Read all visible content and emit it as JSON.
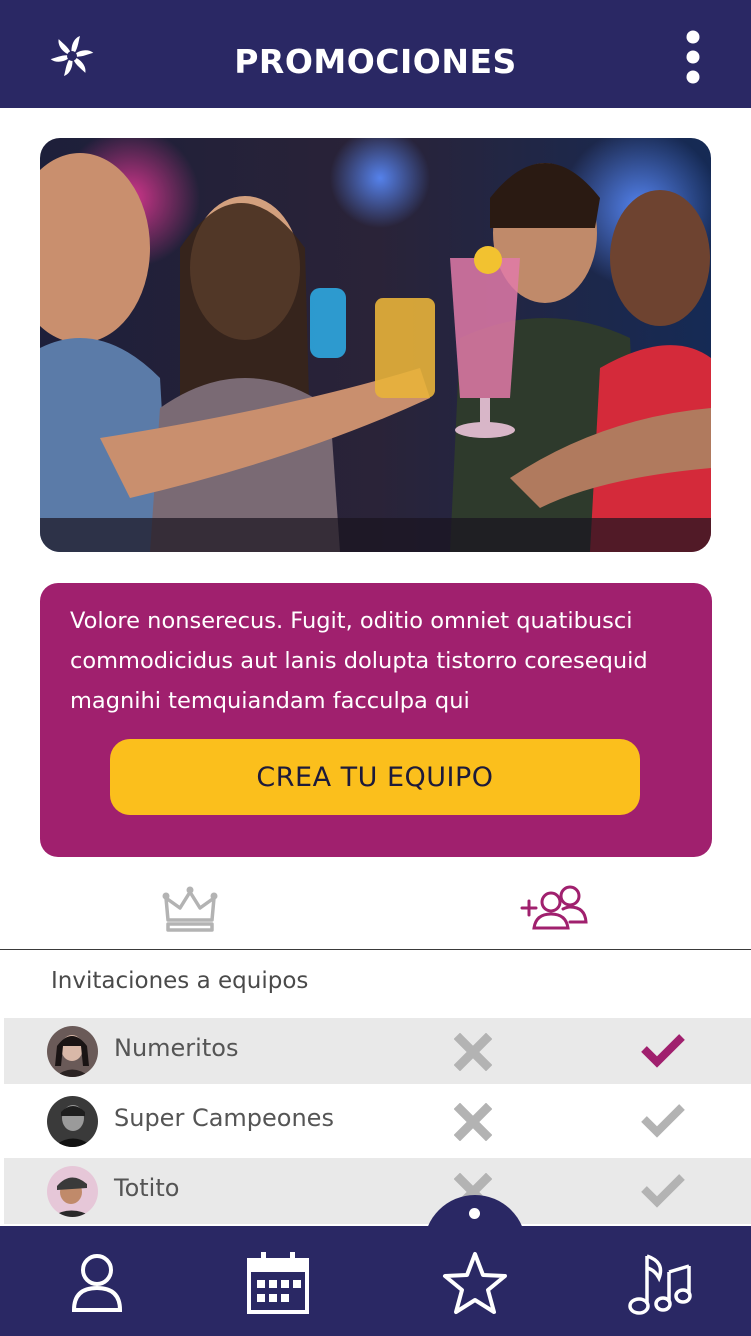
{
  "header": {
    "title": "PROMOCIONES",
    "logo_icon": "pinwheel-logo-icon",
    "menu_icon": "kebab-menu-icon"
  },
  "colors": {
    "navy": "#2a2864",
    "magenta": "#a0206e",
    "yellow": "#fbbf1c"
  },
  "promo": {
    "text": "Volore nonserecus. Fugit, oditio omniet quatibusci commodicidus aut lanis dolupta tistorro coresequid magnihi temquiandam facculpa qui",
    "cta_label": "CREA TU EQUIPO"
  },
  "tabs": [
    {
      "icon": "crown-icon",
      "active": false
    },
    {
      "icon": "add-group-icon",
      "active": true
    }
  ],
  "invitations": {
    "title": "Invitaciones a equipos",
    "rows": [
      {
        "name": "Numeritos",
        "accepted": true
      },
      {
        "name": "Super Campeones",
        "accepted": false
      },
      {
        "name": "Totito",
        "accepted": false
      }
    ]
  },
  "bottom_nav": [
    {
      "icon": "user-icon"
    },
    {
      "icon": "calendar-icon"
    },
    {
      "icon": "star-icon",
      "active": true
    },
    {
      "icon": "music-notes-icon"
    }
  ]
}
